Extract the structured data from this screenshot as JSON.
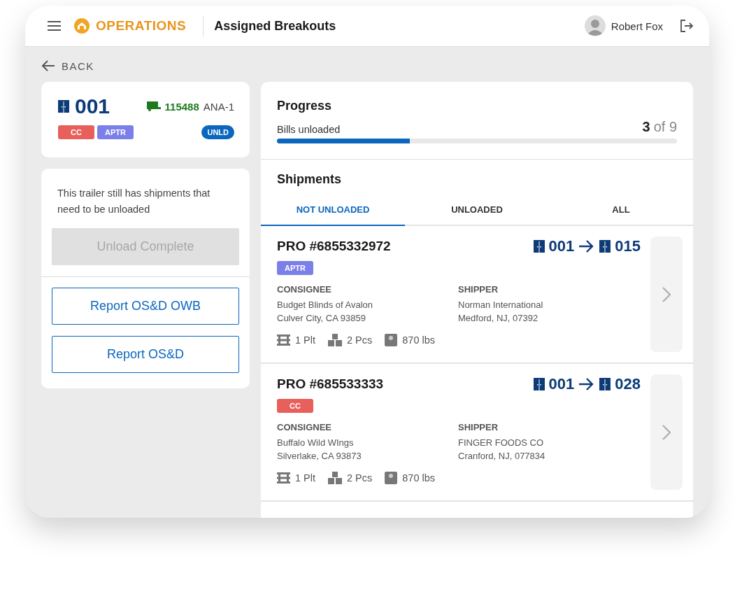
{
  "header": {
    "app_name": "OPERATIONS",
    "page_title": "Assigned Breakouts",
    "user_name": "Robert Fox"
  },
  "back": {
    "label": "BACK"
  },
  "trailer": {
    "door": "001",
    "trailer_number": "115488",
    "location": "ANA-1",
    "tags": [
      {
        "label": "CC",
        "color": "#e8605c"
      },
      {
        "label": "APTR",
        "color": "#7b7fe8"
      }
    ],
    "status": {
      "label": "UNLD",
      "color": "#0b66bd"
    }
  },
  "actions": {
    "message": "This trailer still has shipments that need to be unloaded",
    "buttons": [
      {
        "label": "Unload Complete",
        "kind": "filled",
        "disabled": true
      },
      {
        "label": "Report OS&D OWB",
        "kind": "outline",
        "disabled": false
      },
      {
        "label": "Report OS&D",
        "kind": "outline",
        "disabled": false
      }
    ]
  },
  "progress": {
    "title": "Progress",
    "label": "Bills unloaded",
    "count": "3",
    "of_total": "of 9",
    "level": 0.333
  },
  "shipments": {
    "title": "Shipments",
    "tabs": [
      {
        "label": "NOT UNLOADED",
        "selected": true
      },
      {
        "label": "UNLOADED",
        "selected": false
      },
      {
        "label": "ALL",
        "selected": false
      }
    ],
    "items": [
      {
        "pro": "PRO #6855332972",
        "from_door": "001",
        "to_door": "015",
        "tags": [
          {
            "label": "APTR",
            "color": "#7b7fe8"
          }
        ],
        "consignee_label": "CONSIGNEE",
        "consignee_name": "Budget Blinds of Avalon",
        "consignee_address": "Culver City, CA 93859",
        "shipper_label": "SHIPPER",
        "shipper_name": "Norman International",
        "shipper_address": "Medford, NJ, 07392",
        "pallets": "1 Plt",
        "pieces": "2 Pcs",
        "weight": "870 lbs"
      },
      {
        "pro": "PRO #685533333",
        "from_door": "001",
        "to_door": "028",
        "tags": [
          {
            "label": "CC",
            "color": "#e8605c"
          }
        ],
        "consignee_label": "CONSIGNEE",
        "consignee_name": "Buffalo Wild WIngs",
        "consignee_address": "Silverlake, CA 93873",
        "shipper_label": "SHIPPER",
        "shipper_name": "FINGER FOODS CO",
        "shipper_address": "Cranford, NJ, 077834",
        "pallets": "1 Plt",
        "pieces": "2 Pcs",
        "weight": "870 lbs"
      }
    ]
  }
}
